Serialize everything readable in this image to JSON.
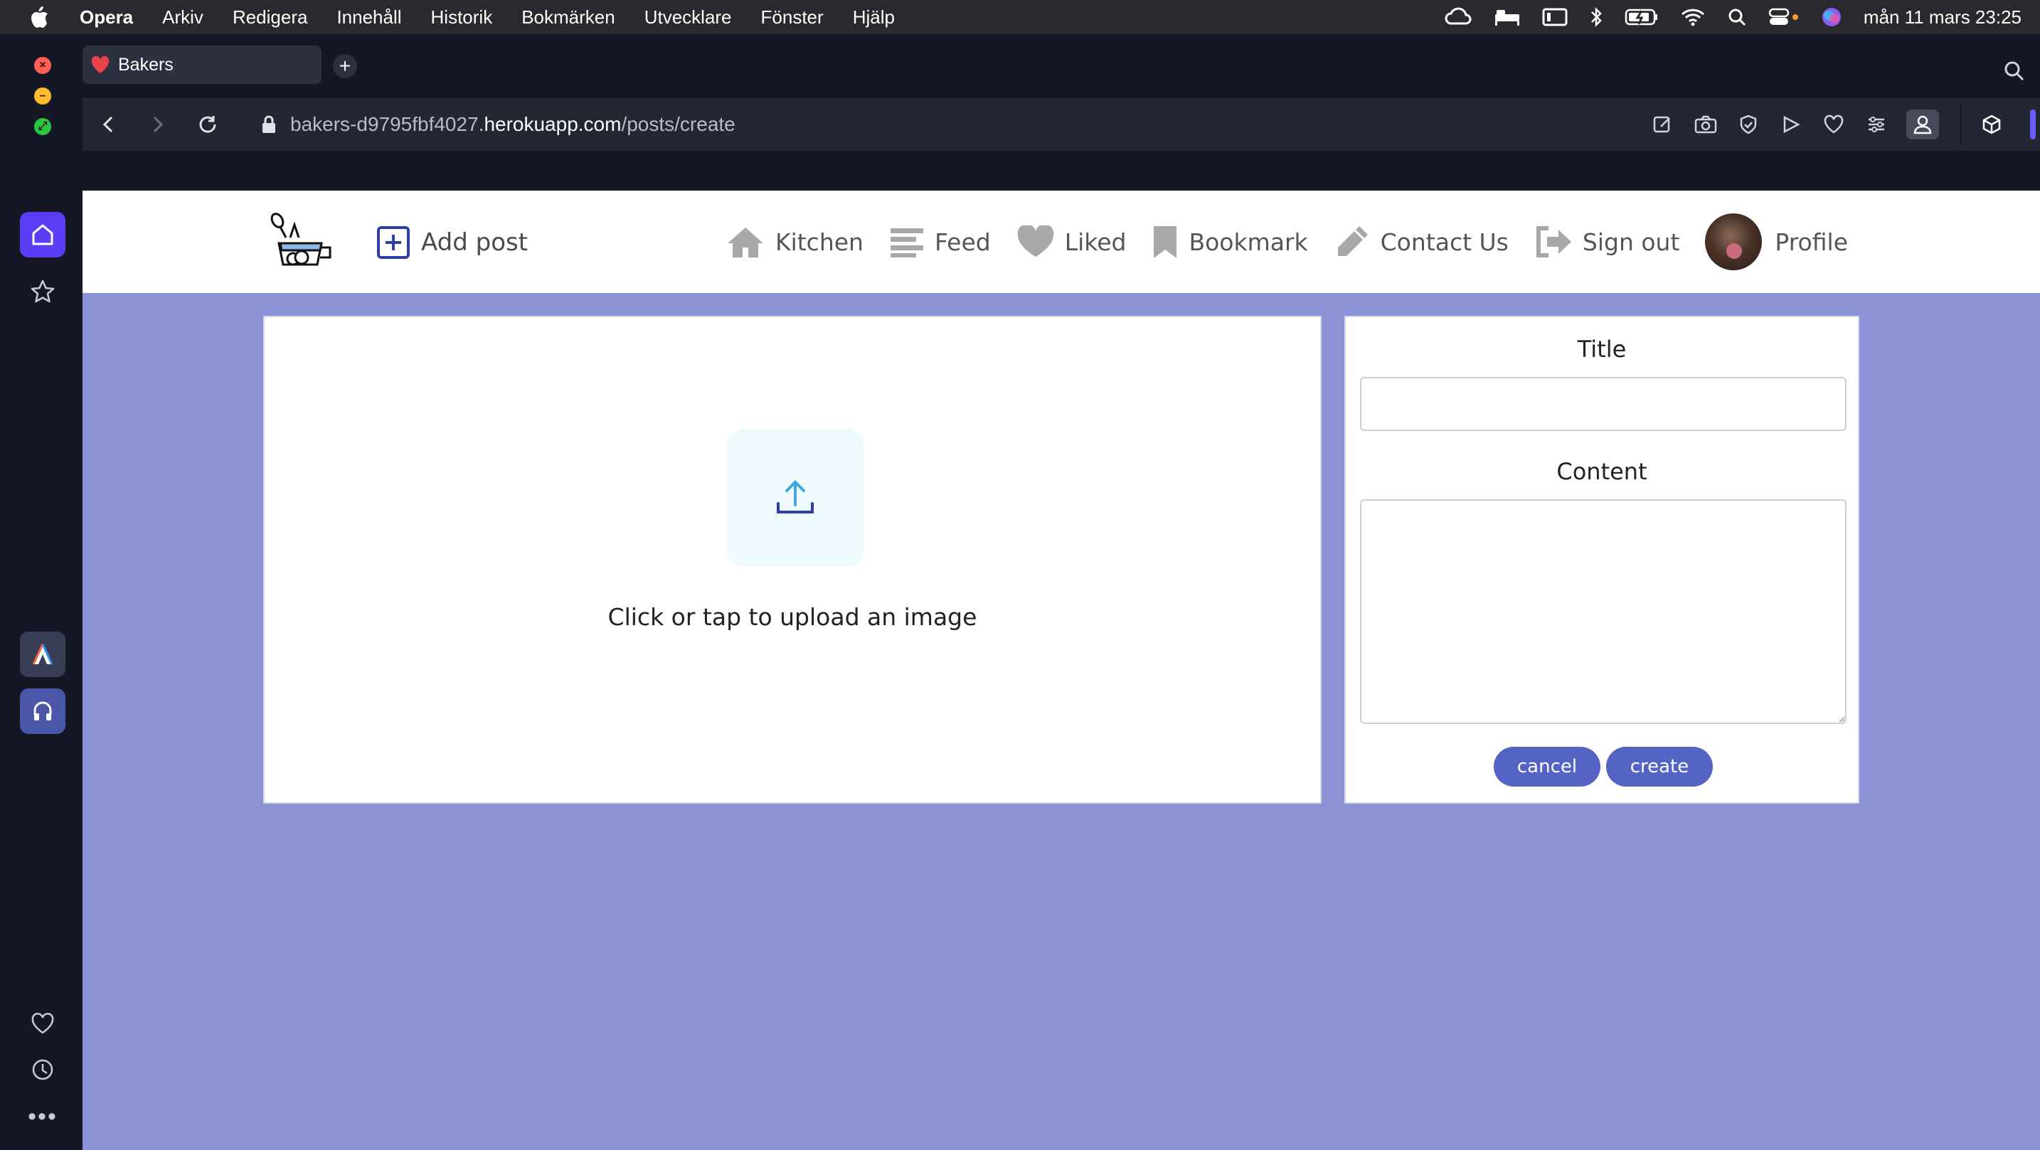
{
  "menubar": {
    "app_name": "Opera",
    "items": [
      "Arkiv",
      "Redigera",
      "Innehåll",
      "Historik",
      "Bokmärken",
      "Utvecklare",
      "Fönster",
      "Hjälp"
    ],
    "clock": "mån 11 mars 23:25"
  },
  "browser": {
    "tab_title": "Bakers",
    "url_prefix": "bakers-d9795fbf4027.",
    "url_host": "herokuapp.com",
    "url_path": "/posts/create",
    "accent_color": "#5a3df5"
  },
  "site_nav": {
    "add_post": "Add post",
    "links": {
      "kitchen": "Kitchen",
      "feed": "Feed",
      "liked": "Liked",
      "bookmark": "Bookmark",
      "contact": "Contact Us",
      "signout": "Sign out",
      "profile": "Profile"
    }
  },
  "upload": {
    "text": "Click or tap to upload an image"
  },
  "form": {
    "title_label": "Title",
    "title_value": "",
    "content_label": "Content",
    "content_value": "",
    "cancel_label": "cancel",
    "create_label": "create",
    "button_color": "#5563c4"
  },
  "page_background": "#8b93d6"
}
